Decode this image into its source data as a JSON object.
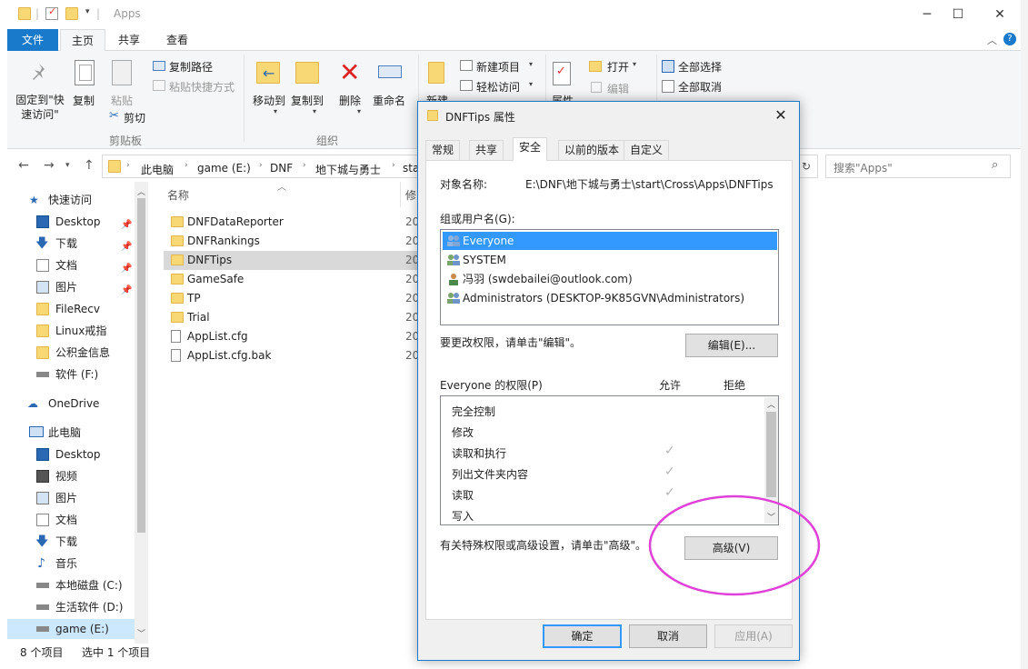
{
  "window": {
    "title": "Apps",
    "buttons": [
      "─",
      "☐",
      "✕"
    ]
  },
  "ribbon_tabs": [
    "文件",
    "主页",
    "共享",
    "查看"
  ],
  "ribbon": {
    "pin_quick": "固定到\"快速访问\"",
    "copy": "复制",
    "paste": "粘贴",
    "copy_path": "复制路径",
    "paste_shortcut": "粘贴快捷方式",
    "cut": "剪切",
    "group_clipboard": "剪贴板",
    "move_to": "移动到",
    "copy_to": "复制到",
    "delete": "删除",
    "rename": "重命名",
    "group_organize": "组织",
    "new_item": "新建项目",
    "easy_access": "轻松访问",
    "new_folder": "新建",
    "open": "打开",
    "edit": "编辑",
    "properties": "属性",
    "select_all": "全部选择",
    "select_none": "全部取消"
  },
  "address": {
    "crumbs": [
      "此电脑",
      "game (E:)",
      "DNF",
      "地下城与勇士",
      "sta"
    ],
    "search_placeholder": "搜索\"Apps\""
  },
  "nav": {
    "quick_access": "快速访问",
    "items_quick": [
      {
        "label": "Desktop",
        "pinned": true
      },
      {
        "label": "下载",
        "pinned": true
      },
      {
        "label": "文档",
        "pinned": true
      },
      {
        "label": "图片",
        "pinned": true
      },
      {
        "label": "FileRecv",
        "pinned": false
      },
      {
        "label": "Linux戒指",
        "pinned": false
      },
      {
        "label": "公积金信息",
        "pinned": false
      },
      {
        "label": "软件 (F:)",
        "pinned": false
      }
    ],
    "onedrive": "OneDrive",
    "this_pc": "此电脑",
    "items_pc": [
      "Desktop",
      "视频",
      "图片",
      "文档",
      "下载",
      "音乐",
      "本地磁盘 (C:)",
      "生活软件 (D:)",
      "game (E:)"
    ]
  },
  "filelist": {
    "col_name": "名称",
    "col_date_partial": "修",
    "files": [
      {
        "name": "DNFDataReporter",
        "type": "folder",
        "date": "20"
      },
      {
        "name": "DNFRankings",
        "type": "folder",
        "date": "20"
      },
      {
        "name": "DNFTips",
        "type": "folder",
        "date": "20"
      },
      {
        "name": "GameSafe",
        "type": "folder",
        "date": "20"
      },
      {
        "name": "TP",
        "type": "folder",
        "date": "20"
      },
      {
        "name": "Trial",
        "type": "folder",
        "date": "20"
      },
      {
        "name": "AppList.cfg",
        "type": "file",
        "date": "20"
      },
      {
        "name": "AppList.cfg.bak",
        "type": "file",
        "date": "20"
      }
    ]
  },
  "status": {
    "count": "8 个项目",
    "selected": "选中 1 个项目"
  },
  "dialog": {
    "title": "DNFTips 属性",
    "tabs": [
      "常规",
      "共享",
      "安全",
      "以前的版本",
      "自定义"
    ],
    "object_label": "对象名称:",
    "object_value": "E:\\DNF\\地下城与勇士\\start\\Cross\\Apps\\DNFTips",
    "group_label": "组或用户名(G):",
    "users": [
      "Everyone",
      "SYSTEM",
      "冯羽 (swdebailei@outlook.com)",
      "Administrators (DESKTOP-9K85GVN\\Administrators)"
    ],
    "change_hint": "要更改权限，请单击\"编辑\"。",
    "edit_button": "编辑(E)...",
    "perm_title": "Everyone 的权限(P)",
    "allow": "允许",
    "deny": "拒绝",
    "perms": [
      {
        "name": "完全控制",
        "allow": false
      },
      {
        "name": "修改",
        "allow": false
      },
      {
        "name": "读取和执行",
        "allow": true
      },
      {
        "name": "列出文件夹内容",
        "allow": true
      },
      {
        "name": "读取",
        "allow": true
      },
      {
        "name": "写入",
        "allow": false
      }
    ],
    "advanced_hint": "有关特殊权限或高级设置，请单击\"高级\"。",
    "advanced_button": "高级(V)",
    "ok": "确定",
    "cancel": "取消",
    "apply": "应用(A)"
  },
  "colors": {
    "accent": "#1979ca",
    "selection": "#3399ff",
    "annotation": "#e040d8"
  }
}
